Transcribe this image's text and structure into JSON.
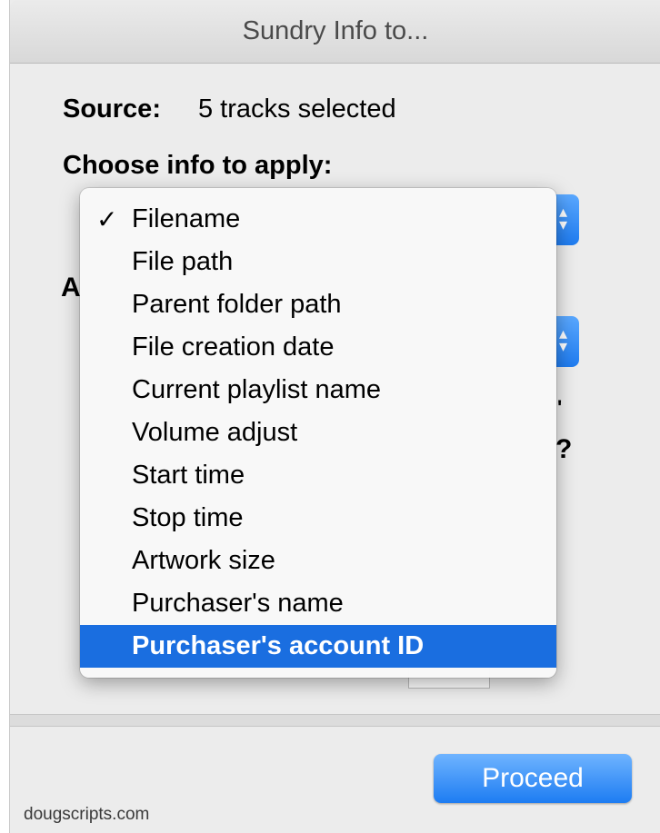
{
  "window": {
    "title": "Sundry Info to..."
  },
  "source": {
    "label": "Source:",
    "value": "5 tracks selected"
  },
  "choose_info": {
    "label": "Choose info to apply:"
  },
  "menu": {
    "checked_index": 0,
    "highlighted_index": 10,
    "items": [
      {
        "label": "Filename"
      },
      {
        "label": "File path"
      },
      {
        "label": "Parent folder path"
      },
      {
        "label": "File creation date"
      },
      {
        "label": "Current playlist name"
      },
      {
        "label": "Volume adjust"
      },
      {
        "label": "Start time"
      },
      {
        "label": "Stop time"
      },
      {
        "label": "Artwork size"
      },
      {
        "label": "Purchaser's name"
      },
      {
        "label": "Purchaser's account ID"
      }
    ]
  },
  "obscured": {
    "second_label_fragment": "A",
    "question_fragment": "?",
    "apostrophe_fragment": "'"
  },
  "buttons": {
    "proceed": "Proceed"
  },
  "footer": {
    "credit": "dougscripts.com"
  },
  "colors": {
    "accent": "#1a6ee0",
    "button_top": "#6fb4ff",
    "button_bottom": "#1d7cf2",
    "window_bg": "#ececec"
  },
  "icons": {
    "check": "✓",
    "popup_arrows": "updown-chevron-icon"
  }
}
